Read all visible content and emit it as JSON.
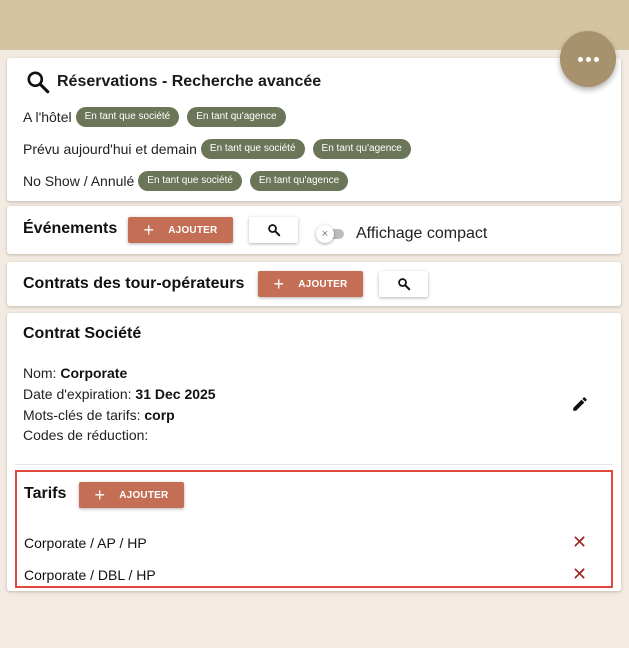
{
  "fab": {
    "icon": "more-horizontal-icon"
  },
  "reservations": {
    "title": "Réservations - Recherche avancée",
    "rows": [
      {
        "label": "A l'hôtel",
        "chips": [
          "En tant que société",
          "En tant qu'agence"
        ]
      },
      {
        "label": "Prévu aujourd'hui et demain",
        "chips": [
          "En tant que société",
          "En tant qu'agence"
        ]
      },
      {
        "label": "No Show / Annulé",
        "chips": [
          "En tant que société",
          "En tant qu'agence"
        ]
      }
    ]
  },
  "events": {
    "title": "Événements",
    "add_label": "AJOUTER",
    "compact_label": "Affichage compact",
    "compact_on": false
  },
  "tour_operators": {
    "title": "Contrats des tour-opérateurs",
    "add_label": "AJOUTER"
  },
  "company_contract": {
    "title": "Contrat Société",
    "name_label": "Nom:",
    "name_value": "Corporate",
    "expiry_label": "Date d'expiration:",
    "expiry_value": "31 Dec 2025",
    "keywords_label": "Mots-clés de tarifs:",
    "keywords_value": "corp",
    "codes_label": "Codes de réduction:",
    "codes_value": ""
  },
  "tarifs": {
    "title": "Tarifs",
    "add_label": "AJOUTER",
    "items": [
      "Corporate / AP / HP",
      "Corporate / DBL / HP"
    ]
  },
  "colors": {
    "topbar": "#d5c4a1",
    "fab": "#a8926e",
    "chip": "#6b7558",
    "add_button": "#c46f55",
    "highlight_border": "#e0473f",
    "delete_icon": "#9a2a23"
  }
}
